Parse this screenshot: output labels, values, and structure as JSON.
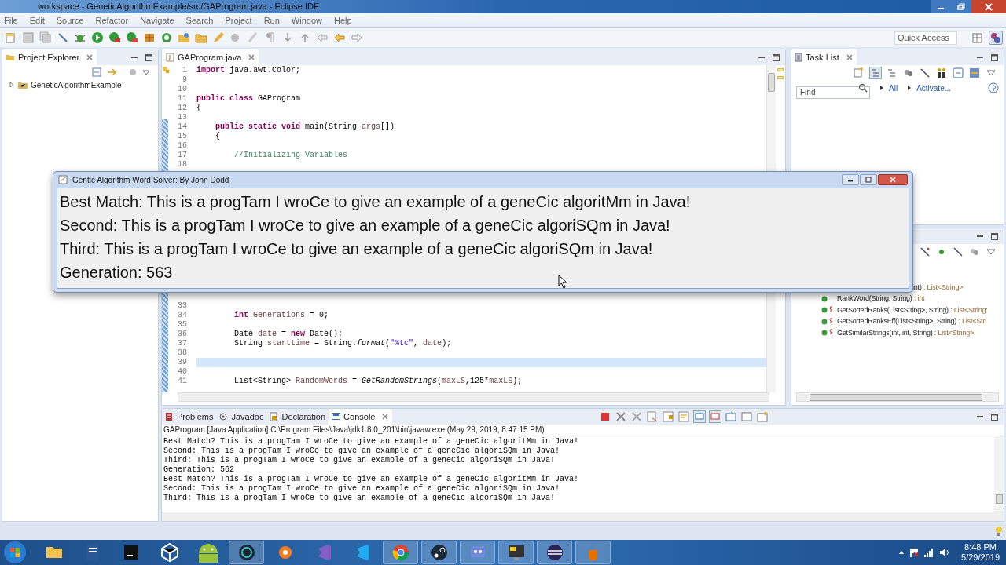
{
  "window": {
    "title": "workspace - GeneticAlgorithmExample/src/GAProgram.java - Eclipse IDE"
  },
  "menu": [
    "File",
    "Edit",
    "Source",
    "Refactor",
    "Navigate",
    "Search",
    "Project",
    "Run",
    "Window",
    "Help"
  ],
  "quick_access": {
    "placeholder": "Quick Access"
  },
  "project_explorer": {
    "tab": "Project Explorer",
    "tree": [
      {
        "label": "GeneticAlgorithmExample",
        "expanded": false
      }
    ]
  },
  "editor": {
    "tab": "GAProgram.java",
    "lines": [
      {
        "n": "1",
        "current": false,
        "code": [
          {
            "text": "import",
            "kind": "keyword"
          },
          {
            "text": " java.awt.Color;",
            "kind": "plain"
          }
        ]
      },
      {
        "n": "9",
        "current": false
      },
      {
        "n": "10",
        "current": false
      },
      {
        "n": "11",
        "current": false,
        "code": [
          {
            "text": "public class",
            "kind": "keyword"
          },
          {
            "text": " GAProgram",
            "kind": "plain"
          }
        ]
      },
      {
        "n": "12",
        "current": false,
        "code": [
          {
            "text": "{",
            "kind": "plain"
          }
        ]
      },
      {
        "n": "13",
        "current": false
      },
      {
        "n": "14",
        "current": false,
        "code": [
          {
            "text": "    public static void",
            "kind": "keyword"
          },
          {
            "text": " main(String ",
            "kind": "plain"
          },
          {
            "text": "args",
            "kind": "variable"
          },
          {
            "text": "[])",
            "kind": "plain"
          }
        ]
      },
      {
        "n": "15",
        "current": false,
        "code": [
          {
            "text": "    {",
            "kind": "plain"
          }
        ]
      },
      {
        "n": "16",
        "current": false
      },
      {
        "n": "17",
        "current": false,
        "code": [
          {
            "text": "        //Initializing Variables",
            "kind": "comment"
          }
        ]
      },
      {
        "n": "18",
        "current": false
      },
      {
        "n": "33",
        "current": false
      },
      {
        "n": "34",
        "current": false,
        "code": [
          {
            "text": "        int ",
            "kind": "keyword"
          },
          {
            "text": "Generations",
            "kind": "variable"
          },
          {
            "text": " = 0;",
            "kind": "plain"
          }
        ]
      },
      {
        "n": "35",
        "current": false
      },
      {
        "n": "36",
        "current": false,
        "code": [
          {
            "text": "        Date ",
            "kind": "plain"
          },
          {
            "text": "date",
            "kind": "variable"
          },
          {
            "text": " = ",
            "kind": "plain"
          },
          {
            "text": "new",
            "kind": "keyword"
          },
          {
            "text": " Date();",
            "kind": "plain"
          }
        ]
      },
      {
        "n": "37",
        "current": false,
        "code": [
          {
            "text": "        String ",
            "kind": "plain"
          },
          {
            "text": "starttime",
            "kind": "variable"
          },
          {
            "text": " = String.",
            "kind": "plain"
          },
          {
            "text": "format",
            "kind": "method"
          },
          {
            "text": "(",
            "kind": "plain"
          },
          {
            "text": "\"%tc\"",
            "kind": "string"
          },
          {
            "text": ", ",
            "kind": "plain"
          },
          {
            "text": "date",
            "kind": "variable"
          },
          {
            "text": ");",
            "kind": "plain"
          }
        ]
      },
      {
        "n": "38",
        "current": false
      },
      {
        "n": "39",
        "current": true
      },
      {
        "n": "40",
        "current": false
      },
      {
        "n": "41",
        "current": false,
        "code": [
          {
            "text": "        List<String> ",
            "kind": "plain"
          },
          {
            "text": "RandomWords",
            "kind": "variable"
          },
          {
            "text": " = ",
            "kind": "plain"
          },
          {
            "text": "GetRandomStrings",
            "kind": "method"
          },
          {
            "text": "(",
            "kind": "plain"
          },
          {
            "text": "maxLS",
            "kind": "variable"
          },
          {
            "text": ",125*",
            "kind": "plain"
          },
          {
            "text": "maxLS",
            "kind": "variable"
          },
          {
            "text": ");",
            "kind": "plain"
          }
        ]
      }
    ]
  },
  "task_list": {
    "tab": "Task List",
    "find": {
      "placeholder": "Find"
    },
    "links": [
      "All",
      "Activate..."
    ]
  },
  "outline": {
    "partial_item": {
      "name": "int)",
      "type": ": List<String>"
    },
    "items": [
      {
        "name": "RankWord(String, String)",
        "type": ": int",
        "static": false
      },
      {
        "name": "GetSortedRanks(List<String>, String)",
        "type": ": List<String:",
        "static": true
      },
      {
        "name": "GetSortedRanksEff(List<String>, String)",
        "type": ": List<Stri",
        "static": true
      },
      {
        "name": "GetSimilarStrings(int, int, String)",
        "type": ": List<String>",
        "static": true
      }
    ]
  },
  "console": {
    "tabs": [
      {
        "label": "Problems",
        "selected": false
      },
      {
        "label": "Javadoc",
        "selected": false
      },
      {
        "label": "Declaration",
        "selected": false
      },
      {
        "label": "Console",
        "selected": true
      }
    ],
    "header": "GAProgram [Java Application] C:\\Program Files\\Java\\jdk1.8.0_201\\bin\\javaw.exe (May 29, 2019, 8:47:15 PM)",
    "lines": [
      "Best Match? This is a progTam I wroCe to give an example of a geneCic algoritMm in Java!",
      "Second: This is a progTam I wroCe to give an example of a geneCic algoriSQm in Java!",
      "Third: This is a progTam I wroCe to give an example of a geneCic algoriSQm in Java!",
      "Generation: 562",
      "Best Match? This is a progTam I wroCe to give an example of a geneCic algoritMm in Java!",
      "Second: This is a progTam I wroCe to give an example of a geneCic algoriSQm in Java!",
      "Third: This is a progTam I wroCe to give an example of a geneCic algoriSQm in Java!"
    ]
  },
  "solver_window": {
    "title": "Gentic Algorithm Word Solver: By John Dodd",
    "lines": [
      "Best Match: This is a progTam I wroCe to give an example of a geneCic algoritMm in Java!",
      "Second: This is a progTam I wroCe to give an example of a geneCic algoriSQm in Java!",
      "Third: This is a progTam I wroCe to give an example of a geneCic algoriSQm in Java!",
      "Generation: 563"
    ]
  },
  "taskbar": {
    "time": "8:48 PM",
    "date": "5/29/2019"
  }
}
